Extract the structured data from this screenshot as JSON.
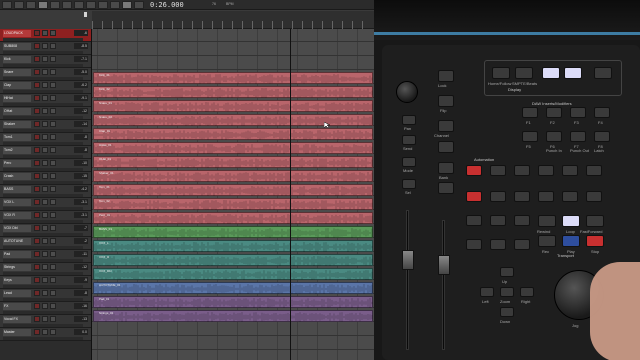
{
  "toolbar": {
    "counter": "0:26.000",
    "tempo_a": "76",
    "tempo_b": "BPM",
    "tools": [
      "ZOOM",
      "TRIM",
      "SEL",
      "GRAB",
      "SMART",
      "PENCIL"
    ],
    "modes": [
      "SHUF",
      "SLIP",
      "SPOT",
      "GRID"
    ],
    "transport": [
      "LOOP",
      "REPEAT"
    ]
  },
  "tracks": [
    {
      "name": "LOUDPACK",
      "volume": "-6",
      "selected": true,
      "color": "#a84040"
    },
    {
      "name": "SUB808",
      "volume": "-8.5",
      "selected": false,
      "color": "#b9656b"
    },
    {
      "name": "Kick",
      "volume": "-7.1",
      "selected": false,
      "color": "#b9656b"
    },
    {
      "name": "Snare",
      "volume": "-5.0",
      "selected": false,
      "color": "#b9656b"
    },
    {
      "name": "Clap",
      "volume": "-6.2",
      "selected": false,
      "color": "#b9656b"
    },
    {
      "name": "HiHat",
      "volume": "-9.1",
      "selected": false,
      "color": "#b9656b"
    },
    {
      "name": "OHat",
      "volume": "-12",
      "selected": false,
      "color": "#b9656b"
    },
    {
      "name": "Shaker",
      "volume": "-14",
      "selected": false,
      "color": "#b9656b"
    },
    {
      "name": "Tom1",
      "volume": "-8",
      "selected": false,
      "color": "#b9656b"
    },
    {
      "name": "Tom2",
      "volume": "-8",
      "selected": false,
      "color": "#b9656b"
    },
    {
      "name": "Perc",
      "volume": "-10",
      "selected": false,
      "color": "#b9656b"
    },
    {
      "name": "Crash",
      "volume": "-15",
      "selected": false,
      "color": "#b9656b"
    },
    {
      "name": "BASS",
      "volume": "-4.2",
      "selected": false,
      "color": "#5a9a5a"
    },
    {
      "name": "VOX L",
      "volume": "-3.1",
      "selected": false,
      "color": "#4a8a82"
    },
    {
      "name": "VOX R",
      "volume": "-3.1",
      "selected": false,
      "color": "#4a8a82"
    },
    {
      "name": "VOX Dbl",
      "volume": "-7",
      "selected": false,
      "color": "#4a8a82"
    },
    {
      "name": "AUTOTUNE",
      "volume": "-2",
      "selected": false,
      "color": "#5a75a8"
    },
    {
      "name": "Pad",
      "volume": "-11",
      "selected": false,
      "color": "#7a5d8a"
    },
    {
      "name": "Strings",
      "volume": "-12",
      "selected": false,
      "color": "#7a5d8a"
    },
    {
      "name": "Keys",
      "volume": "-9",
      "selected": false,
      "color": "#7a5d8a"
    },
    {
      "name": "Lead",
      "volume": "-8",
      "selected": false,
      "color": "#7a5d8a"
    },
    {
      "name": "FX",
      "volume": "-16",
      "selected": false,
      "color": "#7a5d8a"
    },
    {
      "name": "Vocal FX",
      "volume": "-13",
      "selected": false,
      "color": "#7a5d8a"
    },
    {
      "name": "Master",
      "volume": "0.0",
      "selected": false,
      "color": "#3a3a3a"
    }
  ],
  "clips": [
    {
      "lane": 3,
      "label": "Kick_01",
      "color": "#b9656b"
    },
    {
      "lane": 4,
      "label": "Kick_02",
      "color": "#b9656b"
    },
    {
      "lane": 5,
      "label": "Snare_01",
      "color": "#b9656b"
    },
    {
      "lane": 6,
      "label": "Snare_02",
      "color": "#b9656b"
    },
    {
      "lane": 7,
      "label": "Clap_01",
      "color": "#b9656b"
    },
    {
      "lane": 8,
      "label": "HiHat_01",
      "color": "#b9656b"
    },
    {
      "lane": 9,
      "label": "OHat_01",
      "color": "#b9656b"
    },
    {
      "lane": 10,
      "label": "Shaker_01",
      "color": "#b9656b"
    },
    {
      "lane": 11,
      "label": "Tom_01",
      "color": "#b9656b"
    },
    {
      "lane": 12,
      "label": "Tom_02",
      "color": "#b9656b"
    },
    {
      "lane": 13,
      "label": "Perc_01",
      "color": "#b9656b"
    },
    {
      "lane": 14,
      "label": "BASS_01",
      "color": "#5a9a5a"
    },
    {
      "lane": 15,
      "label": "VOX_L",
      "color": "#4a8a82"
    },
    {
      "lane": 16,
      "label": "VOX_R",
      "color": "#4a8a82"
    },
    {
      "lane": 17,
      "label": "VOX_Dbl",
      "color": "#4a8a82"
    },
    {
      "lane": 18,
      "label": "AUTOTUNE_01",
      "color": "#5a75a8"
    },
    {
      "lane": 19,
      "label": "Pad_01",
      "color": "#7a5d8a"
    },
    {
      "lane": 20,
      "label": "Strings_01",
      "color": "#7a5d8a"
    }
  ],
  "surface": {
    "lock": "Lock",
    "flip": "Flip",
    "channel": "Channel",
    "bank": "Bank",
    "pan": "Pan",
    "send": "Send",
    "mode": "Mode",
    "sel": "Sel",
    "display": "Display",
    "daw_section": "DAW Inserts/Modifiers",
    "automation": "Automation",
    "transport": "Transport",
    "zoom": "Zoom",
    "left": "Left",
    "right": "Right",
    "up": "Up",
    "down": "Down",
    "home_follow": "Home/Follow",
    "smpte_beats": "SMPTE/Beats",
    "f_keys": [
      "F1",
      "F2",
      "F3",
      "F4",
      "F5",
      "F6",
      "F7",
      "F8"
    ],
    "punch_in": "Punch In",
    "punch_out": "Punch Out",
    "latch": "Latch",
    "rewind": "Rewind",
    "loop": "Loop",
    "fast_forward": "FastForward",
    "stop": "Stop",
    "play": "Play",
    "rec": "Rec",
    "jog": "Jog"
  }
}
